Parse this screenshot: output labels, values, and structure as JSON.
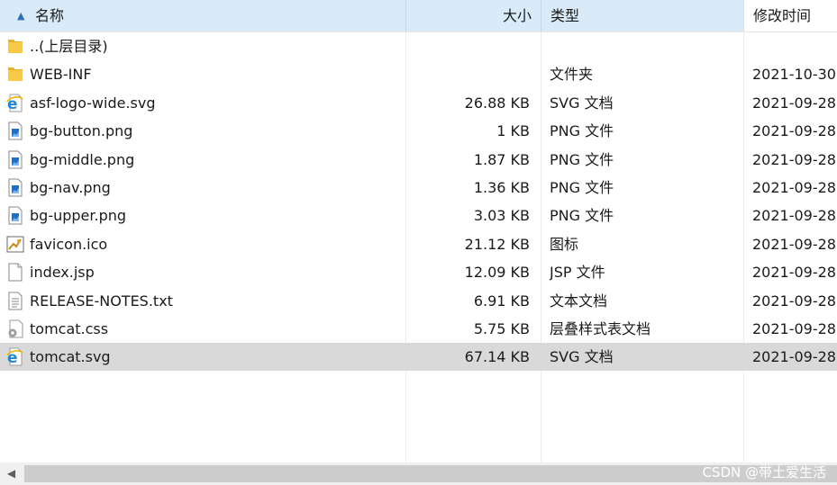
{
  "header": {
    "name": "名称",
    "size": "大小",
    "type": "类型",
    "date": "修改时间"
  },
  "rows": [
    {
      "icon": "folder-icon",
      "name": "..(上层目录)",
      "size": "",
      "type": "",
      "date": ""
    },
    {
      "icon": "folder-icon",
      "name": "WEB-INF",
      "size": "",
      "type": "文件夹",
      "date": "2021-10-30"
    },
    {
      "icon": "ie-svg-icon",
      "name": "asf-logo-wide.svg",
      "size": "26.88 KB",
      "type": "SVG 文档",
      "date": "2021-09-28"
    },
    {
      "icon": "image-file-icon",
      "name": "bg-button.png",
      "size": "1 KB",
      "type": "PNG 文件",
      "date": "2021-09-28"
    },
    {
      "icon": "image-file-icon",
      "name": "bg-middle.png",
      "size": "1.87 KB",
      "type": "PNG 文件",
      "date": "2021-09-28"
    },
    {
      "icon": "image-file-icon",
      "name": "bg-nav.png",
      "size": "1.36 KB",
      "type": "PNG 文件",
      "date": "2021-09-28"
    },
    {
      "icon": "image-file-icon",
      "name": "bg-upper.png",
      "size": "3.03 KB",
      "type": "PNG 文件",
      "date": "2021-09-28"
    },
    {
      "icon": "favicon-icon",
      "name": "favicon.ico",
      "size": "21.12 KB",
      "type": "图标",
      "date": "2021-09-28"
    },
    {
      "icon": "blank-file-icon",
      "name": "index.jsp",
      "size": "12.09 KB",
      "type": "JSP 文件",
      "date": "2021-09-28"
    },
    {
      "icon": "text-file-icon",
      "name": "RELEASE-NOTES.txt",
      "size": "6.91 KB",
      "type": "文本文档",
      "date": "2021-09-28"
    },
    {
      "icon": "css-file-icon",
      "name": "tomcat.css",
      "size": "5.75 KB",
      "type": "层叠样式表文档",
      "date": "2021-09-28"
    },
    {
      "icon": "ie-svg-icon",
      "name": "tomcat.svg",
      "size": "67.14 KB",
      "type": "SVG 文档",
      "date": "2021-09-28",
      "selected": true
    }
  ],
  "watermark": "CSDN @带土爱生活",
  "colors": {
    "header_bg": "#d9ebf9",
    "selected_row": "#d9d9d9",
    "folder": "#f7c948",
    "ie_blue": "#1e88d8",
    "png_blue": "#1f6fc5"
  }
}
